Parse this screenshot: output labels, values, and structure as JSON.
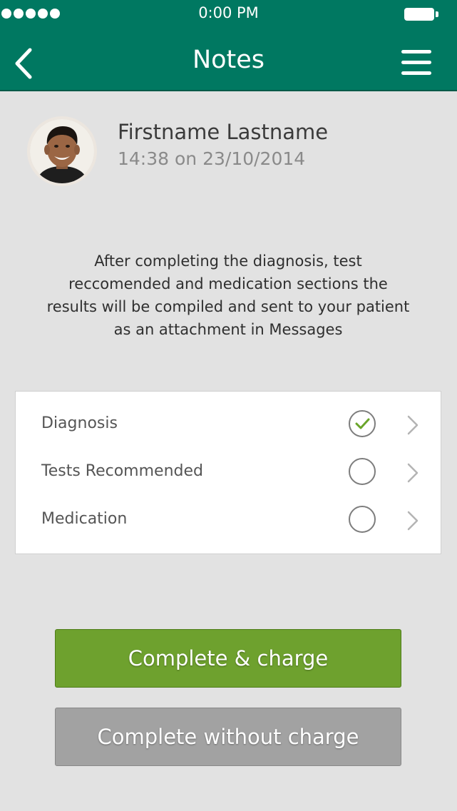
{
  "status_bar": {
    "time": "0:00 PM",
    "signal_dots": 5
  },
  "header": {
    "title": "Notes",
    "background_color": "#007861",
    "back_icon": "chevron-left-icon",
    "menu_icon": "hamburger-menu-icon"
  },
  "profile": {
    "name": "Firstname Lastname",
    "timestamp": "14:38 on 23/10/2014"
  },
  "description": "After completing the diagnosis, test reccomended and medication sections the results will be compiled and sent to your patient as an attachment in Messages",
  "sections": [
    {
      "label": "Diagnosis",
      "completed": true
    },
    {
      "label": "Tests Recommended",
      "completed": false
    },
    {
      "label": "Medication",
      "completed": false
    }
  ],
  "buttons": {
    "complete_charge": "Complete & charge",
    "complete_no_charge": "Complete without charge"
  },
  "colors": {
    "accent_green": "#6ea12e",
    "check_green": "#6aa52a",
    "disabled_gray": "#a2a2a2"
  }
}
